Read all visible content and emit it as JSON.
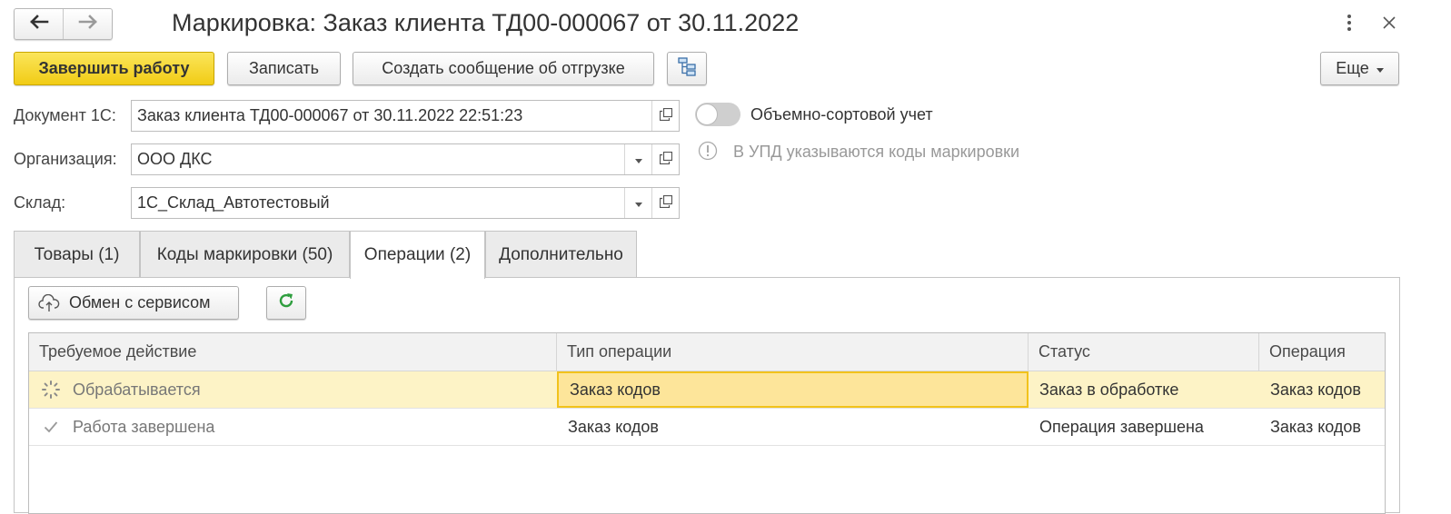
{
  "window": {
    "title": "Маркировка: Заказ клиента ТД00-000067 от 30.11.2022"
  },
  "toolbar": {
    "finish_label": "Завершить работу",
    "save_label": "Записать",
    "create_message_label": "Создать сообщение об отгрузке",
    "more_label": "Еще"
  },
  "form": {
    "document_label": "Документ 1С:",
    "document_value": "Заказ клиента ТД00-000067 от 30.11.2022 22:51:23",
    "organization_label": "Организация:",
    "organization_value": "ООО ДКС",
    "warehouse_label": "Склад:",
    "warehouse_value": "1С_Склад_Автотестовый",
    "volume_sort_label": "Объемно-сортовой учет",
    "volume_sort_on": false,
    "info_text": "В УПД указываются коды маркировки"
  },
  "tabs": [
    {
      "label": "Товары (1)",
      "active": false
    },
    {
      "label": "Коды маркировки (50)",
      "active": false
    },
    {
      "label": "Операции (2)",
      "active": true
    },
    {
      "label": "Дополнительно",
      "active": false
    }
  ],
  "operations": {
    "exchange_label": "Обмен с сервисом",
    "columns": [
      "Требуемое действие",
      "Тип операции",
      "Статус",
      "Операция"
    ],
    "rows": [
      {
        "action": "Обрабатывается",
        "type": "Заказ кодов",
        "status": "Заказ в обработке",
        "operation": "Заказ кодов",
        "icon": "spinner-icon",
        "selected": true
      },
      {
        "action": "Работа завершена",
        "type": "Заказ кодов",
        "status": "Операция завершена",
        "operation": "Заказ кодов",
        "icon": "check-icon",
        "selected": false
      }
    ]
  },
  "colors": {
    "primary_button": "#f1cc15",
    "selected_row": "#fdf3c6",
    "current_cell": "#fde59a",
    "refresh_icon": "#2e9e3e"
  }
}
